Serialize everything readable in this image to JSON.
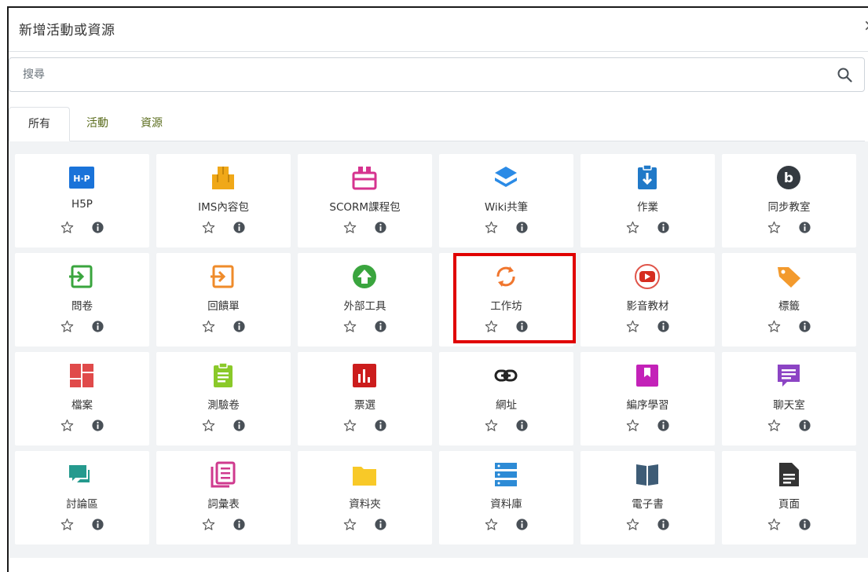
{
  "dialog": {
    "title": "新增活動或資源",
    "close_label": "×"
  },
  "search": {
    "placeholder": "搜尋"
  },
  "tabs": [
    {
      "label": "所有",
      "active": true
    },
    {
      "label": "活動",
      "active": false
    },
    {
      "label": "資源",
      "active": false
    }
  ],
  "tiles": [
    {
      "label": "H5P",
      "icon": "h5p-icon"
    },
    {
      "label": "IMS內容包",
      "icon": "ims-package-icon"
    },
    {
      "label": "SCORM課程包",
      "icon": "scorm-package-icon"
    },
    {
      "label": "Wiki共筆",
      "icon": "wiki-icon"
    },
    {
      "label": "作業",
      "icon": "assignment-icon"
    },
    {
      "label": "同步教室",
      "icon": "bigbluebutton-icon"
    },
    {
      "label": "問卷",
      "icon": "questionnaire-icon"
    },
    {
      "label": "回饋單",
      "icon": "feedback-icon"
    },
    {
      "label": "外部工具",
      "icon": "external-tool-icon"
    },
    {
      "label": "工作坊",
      "icon": "workshop-icon",
      "highlighted": true
    },
    {
      "label": "影音教材",
      "icon": "video-icon"
    },
    {
      "label": "標籤",
      "icon": "label-tag-icon"
    },
    {
      "label": "檔案",
      "icon": "file-icon"
    },
    {
      "label": "測驗卷",
      "icon": "quiz-icon"
    },
    {
      "label": "票選",
      "icon": "choice-icon"
    },
    {
      "label": "網址",
      "icon": "url-link-icon"
    },
    {
      "label": "編序學習",
      "icon": "lesson-icon"
    },
    {
      "label": "聊天室",
      "icon": "chat-icon"
    },
    {
      "label": "討論區",
      "icon": "forum-icon"
    },
    {
      "label": "詞彙表",
      "icon": "glossary-icon"
    },
    {
      "label": "資料夾",
      "icon": "folder-icon"
    },
    {
      "label": "資料庫",
      "icon": "database-icon"
    },
    {
      "label": "電子書",
      "icon": "book-icon"
    },
    {
      "label": "頁面",
      "icon": "page-icon"
    }
  ],
  "colors": {
    "highlight": "#e00000",
    "tab_link": "#5a6c1c"
  }
}
